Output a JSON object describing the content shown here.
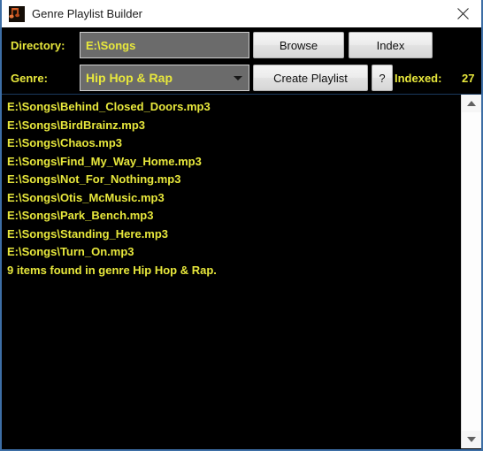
{
  "window": {
    "title": "Genre Playlist Builder",
    "icon": "music-note-icon",
    "close_label": "✕",
    "border_color": "#3d6ea5"
  },
  "colors": {
    "accent_text": "#e8e83c",
    "field_bg": "#6b6b6b",
    "list_bg": "#000000",
    "button_bg": "#ececec"
  },
  "controls": {
    "directory_label": "Directory:",
    "directory_value": "E:\\Songs",
    "directory_placeholder": "",
    "genre_label": "Genre:",
    "genre_selected": "Hip Hop & Rap",
    "genre_options": [
      "Hip Hop & Rap"
    ],
    "browse_label": "Browse",
    "index_label": "Index",
    "create_playlist_label": "Create Playlist",
    "help_label": "?",
    "indexed_label": "Indexed:",
    "indexed_count": "27"
  },
  "list": {
    "items": [
      "E:\\Songs\\Behind_Closed_Doors.mp3",
      "E:\\Songs\\BirdBrainz.mp3",
      "E:\\Songs\\Chaos.mp3",
      "E:\\Songs\\Find_My_Way_Home.mp3",
      "E:\\Songs\\Not_For_Nothing.mp3",
      "E:\\Songs\\Otis_McMusic.mp3",
      "E:\\Songs\\Park_Bench.mp3",
      "E:\\Songs\\Standing_Here.mp3",
      "E:\\Songs\\Turn_On.mp3",
      "9 items found in genre Hip Hop & Rap."
    ]
  },
  "scrollbar": {
    "up_arrow": "scroll-up-icon",
    "down_arrow": "scroll-down-icon"
  }
}
